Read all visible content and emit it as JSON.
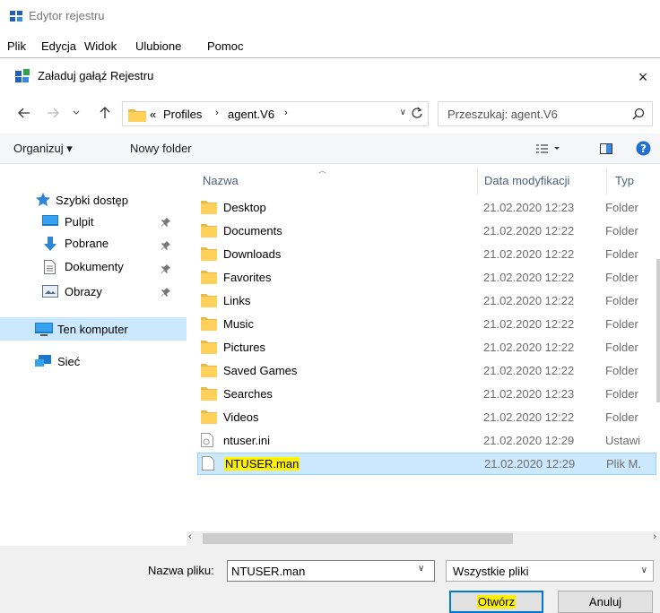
{
  "app": {
    "title": "Edytor rejestru",
    "menu": [
      "Plik",
      "Edycja",
      "Widok",
      "Ulubione",
      "Pomoc"
    ]
  },
  "dialog": {
    "title": "Załaduj gałąź Rejestru",
    "close": "×",
    "address": {
      "overflow": "«",
      "segments": [
        "Profiles",
        "agent.V6"
      ]
    },
    "search": {
      "placeholder": "Przeszukaj: agent.V6"
    },
    "toolbar": {
      "organize": "Organizuj ▾",
      "new_folder": "Nowy folder"
    },
    "navpane": {
      "quick_access": "Szybki dostęp",
      "items": [
        {
          "label": "Pulpit",
          "icon": "desktop-icon"
        },
        {
          "label": "Pobrane",
          "icon": "download-icon"
        },
        {
          "label": "Dokumenty",
          "icon": "document-icon"
        },
        {
          "label": "Obrazy",
          "icon": "pictures-icon"
        }
      ],
      "this_pc": "Ten komputer",
      "network": "Sieć"
    },
    "columns": {
      "name": "Nazwa",
      "date": "Data modyfikacji",
      "type": "Typ"
    },
    "files": [
      {
        "name": "Desktop",
        "date": "21.02.2020 12:23",
        "type": "Folder",
        "kind": "folder"
      },
      {
        "name": "Documents",
        "date": "21.02.2020 12:22",
        "type": "Folder",
        "kind": "folder"
      },
      {
        "name": "Downloads",
        "date": "21.02.2020 12:22",
        "type": "Folder",
        "kind": "folder"
      },
      {
        "name": "Favorites",
        "date": "21.02.2020 12:22",
        "type": "Folder",
        "kind": "folder"
      },
      {
        "name": "Links",
        "date": "21.02.2020 12:22",
        "type": "Folder",
        "kind": "folder"
      },
      {
        "name": "Music",
        "date": "21.02.2020 12:22",
        "type": "Folder",
        "kind": "folder"
      },
      {
        "name": "Pictures",
        "date": "21.02.2020 12:22",
        "type": "Folder",
        "kind": "folder"
      },
      {
        "name": "Saved Games",
        "date": "21.02.2020 12:22",
        "type": "Folder",
        "kind": "folder"
      },
      {
        "name": "Searches",
        "date": "21.02.2020 12:23",
        "type": "Folder",
        "kind": "folder"
      },
      {
        "name": "Videos",
        "date": "21.02.2020 12:22",
        "type": "Folder",
        "kind": "folder"
      },
      {
        "name": "ntuser.ini",
        "date": "21.02.2020 12:29",
        "type": "Ustawi",
        "kind": "ini"
      },
      {
        "name": "NTUSER.man",
        "date": "21.02.2020 12:29",
        "type": "Plik M.",
        "kind": "file",
        "selected": true
      }
    ],
    "filename": {
      "label": "Nazwa pliku:",
      "value": "NTUSER.man"
    },
    "filter": {
      "value": "Wszystkie pliki"
    },
    "buttons": {
      "open": "Otwórz",
      "cancel": "Anuluj"
    },
    "colors": {
      "selection": "#cce8ff",
      "highlight": "#fff200",
      "accent": "#0078d7",
      "folder": "#ffd15a"
    }
  }
}
